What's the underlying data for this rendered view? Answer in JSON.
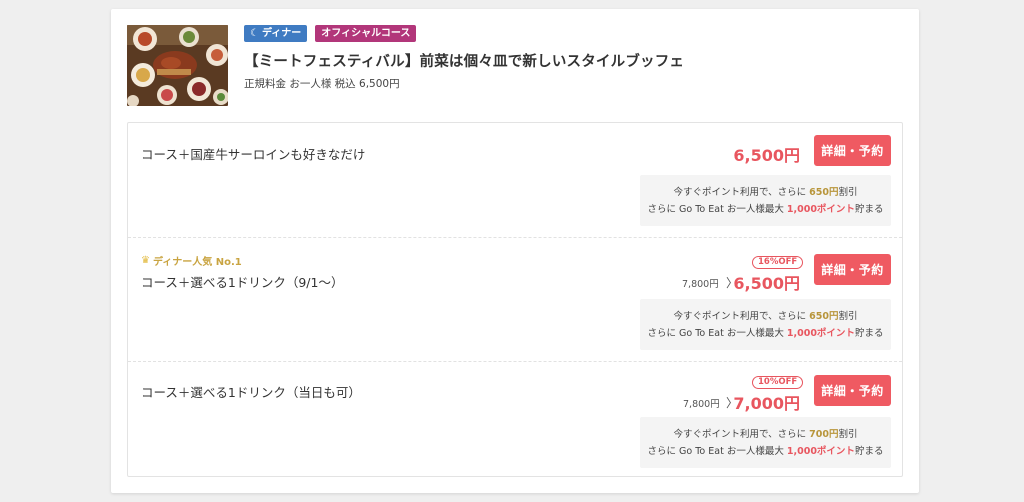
{
  "header": {
    "tags": {
      "dinner": "ディナー",
      "official": "オフィシャルコース"
    },
    "title": "【ミートフェスティバル】前菜は個々皿で新しいスタイルブッフェ",
    "regular_price": "正規料金 お一人様 税込 6,500円",
    "thumb_icon": "food-photo"
  },
  "colors": {
    "dinner_tag": "#3f7bc2",
    "official_tag": "#b2367a",
    "accent": "#ef5a62",
    "price": "#e8565f",
    "gold": "#b8953a"
  },
  "plans": [
    {
      "name": "コース＋国産牛サーロインも好きなだけ",
      "price": "6,500円",
      "button": "詳細・予約",
      "points": {
        "line1_prefix": "今すぐポイント利用で、さらに",
        "line1_amount": "650円",
        "line1_suffix": "割引",
        "line2_prefix": "さらに Go To Eat お一人様最大",
        "line2_amount": "1,000ポイント",
        "line2_suffix": "貯まる"
      }
    },
    {
      "badge": "ディナー人気 No.1",
      "name": "コース＋選べる1ドリンク（9/1〜）",
      "off": "16%OFF",
      "original": "7,800円",
      "arrow": "〉",
      "price": "6,500円",
      "button": "詳細・予約",
      "points": {
        "line1_prefix": "今すぐポイント利用で、さらに",
        "line1_amount": "650円",
        "line1_suffix": "割引",
        "line2_prefix": "さらに Go To Eat お一人様最大",
        "line2_amount": "1,000ポイント",
        "line2_suffix": "貯まる"
      }
    },
    {
      "name": "コース＋選べる1ドリンク（当日も可）",
      "off": "10%OFF",
      "original": "7,800円",
      "arrow": "〉",
      "price": "7,000円",
      "button": "詳細・予約",
      "points": {
        "line1_prefix": "今すぐポイント利用で、さらに",
        "line1_amount": "700円",
        "line1_suffix": "割引",
        "line2_prefix": "さらに Go To Eat お一人様最大",
        "line2_amount": "1,000ポイント",
        "line2_suffix": "貯まる"
      }
    }
  ]
}
